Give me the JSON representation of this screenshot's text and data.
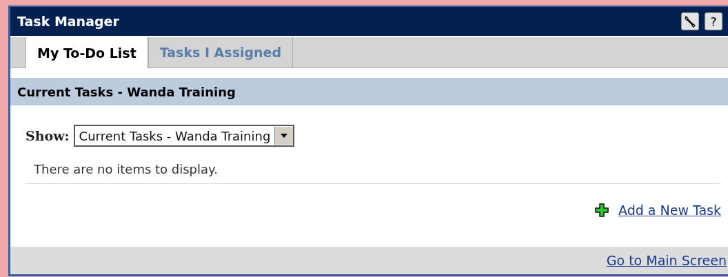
{
  "window": {
    "title": "Task Manager"
  },
  "tabs": [
    {
      "label": "My To-Do List",
      "selected": true
    },
    {
      "label": "Tasks I Assigned",
      "selected": false
    }
  ],
  "section": {
    "title": "Current Tasks - Wanda Training"
  },
  "show": {
    "label": "Show:",
    "value": "Current Tasks - Wanda Training"
  },
  "empty_message": "There are no items to display.",
  "add_link": "Add a New Task",
  "footer_link": "Go to Main Screen",
  "help_button": "?"
}
